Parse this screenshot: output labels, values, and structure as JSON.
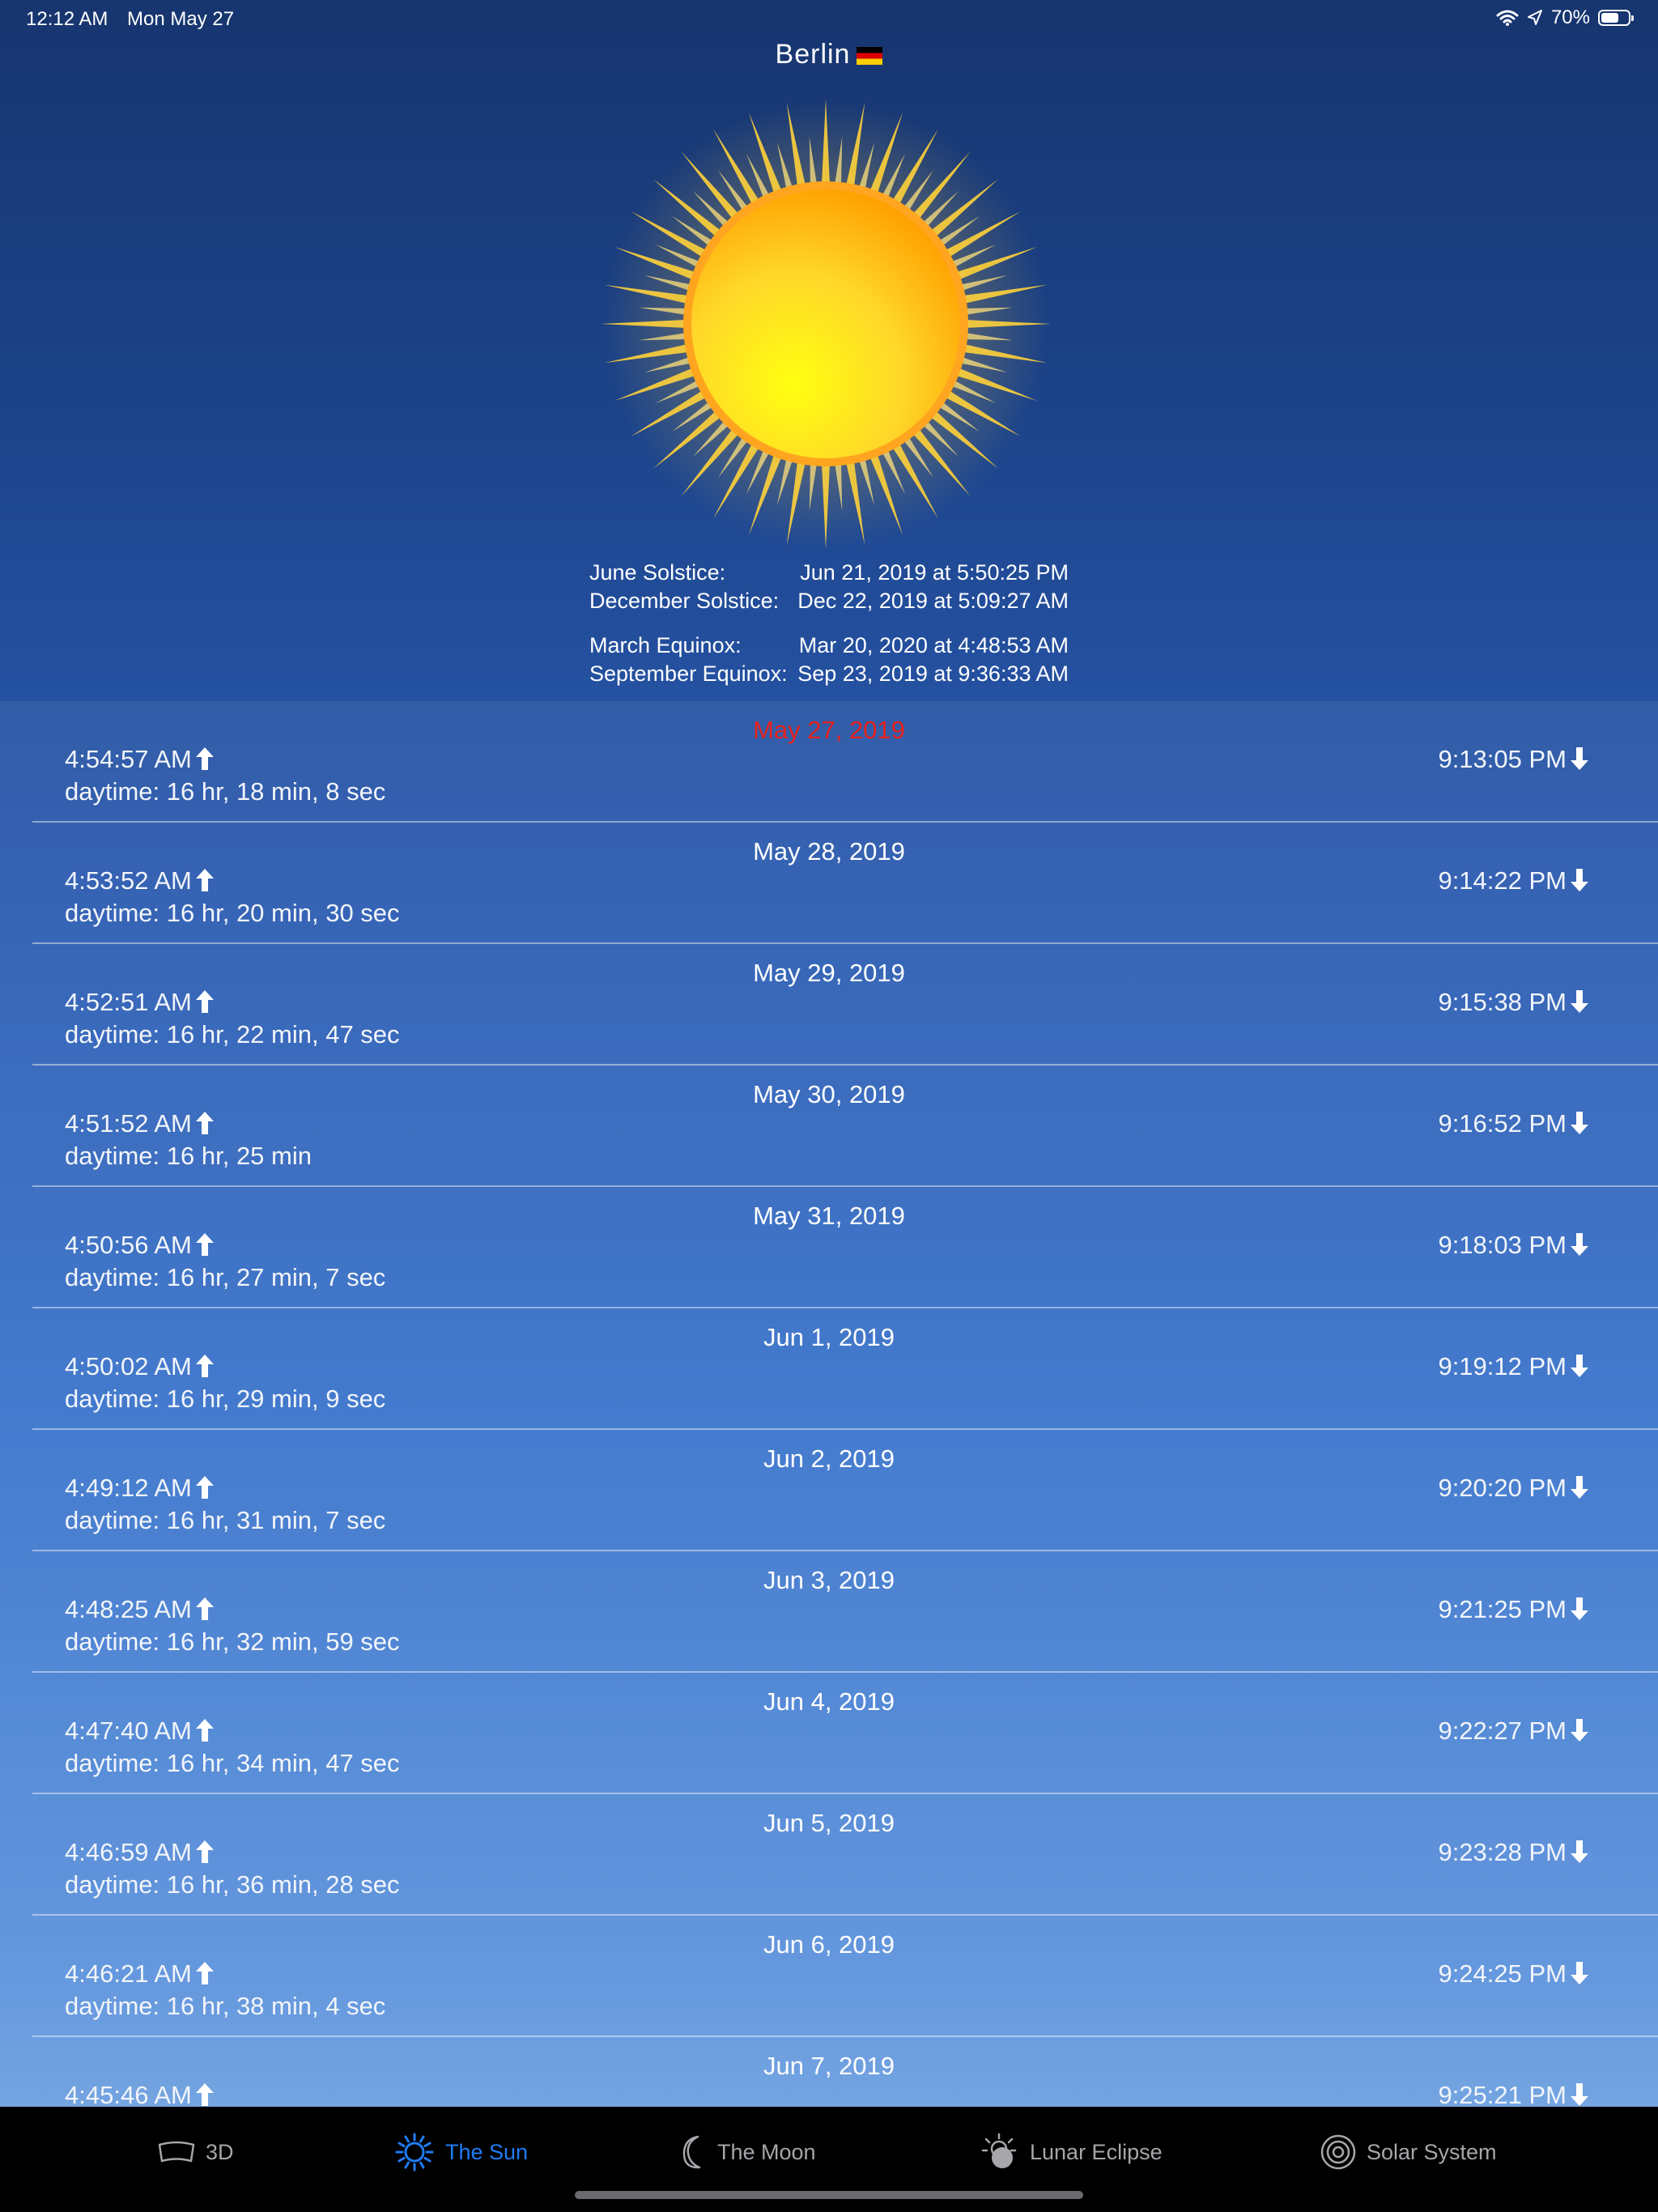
{
  "status": {
    "time": "12:12 AM",
    "date": "Mon May 27",
    "battery": "70%",
    "battery_level": 0.7
  },
  "city": {
    "name": "Berlin"
  },
  "events": [
    {
      "label": "June Solstice:",
      "value": "Jun 21, 2019 at 5:50:25 PM"
    },
    {
      "label": "December Solstice:",
      "value": "Dec 22, 2019 at 5:09:27 AM"
    },
    {
      "label": "March Equinox:",
      "value": "Mar 20, 2020 at 4:48:53 AM"
    },
    {
      "label": "September Equinox:",
      "value": "Sep 23, 2019 at 9:36:33 AM"
    }
  ],
  "days": [
    {
      "date": "May 27, 2019",
      "today": true,
      "rise": "4:54:57 AM",
      "set": "9:13:05 PM",
      "daytime": "daytime: 16 hr, 18 min, 8 sec"
    },
    {
      "date": "May 28, 2019",
      "rise": "4:53:52 AM",
      "set": "9:14:22 PM",
      "daytime": "daytime: 16 hr, 20 min, 30 sec"
    },
    {
      "date": "May 29, 2019",
      "rise": "4:52:51 AM",
      "set": "9:15:38 PM",
      "daytime": "daytime: 16 hr, 22 min, 47 sec"
    },
    {
      "date": "May 30, 2019",
      "rise": "4:51:52 AM",
      "set": "9:16:52 PM",
      "daytime": "daytime: 16 hr, 25 min"
    },
    {
      "date": "May 31, 2019",
      "rise": "4:50:56 AM",
      "set": "9:18:03 PM",
      "daytime": "daytime: 16 hr, 27 min, 7 sec"
    },
    {
      "date": "Jun 1, 2019",
      "rise": "4:50:02 AM",
      "set": "9:19:12 PM",
      "daytime": "daytime: 16 hr, 29 min, 9 sec"
    },
    {
      "date": "Jun 2, 2019",
      "rise": "4:49:12 AM",
      "set": "9:20:20 PM",
      "daytime": "daytime: 16 hr, 31 min, 7 sec"
    },
    {
      "date": "Jun 3, 2019",
      "rise": "4:48:25 AM",
      "set": "9:21:25 PM",
      "daytime": "daytime: 16 hr, 32 min, 59 sec"
    },
    {
      "date": "Jun 4, 2019",
      "rise": "4:47:40 AM",
      "set": "9:22:27 PM",
      "daytime": "daytime: 16 hr, 34 min, 47 sec"
    },
    {
      "date": "Jun 5, 2019",
      "rise": "4:46:59 AM",
      "set": "9:23:28 PM",
      "daytime": "daytime: 16 hr, 36 min, 28 sec"
    },
    {
      "date": "Jun 6, 2019",
      "rise": "4:46:21 AM",
      "set": "9:24:25 PM",
      "daytime": "daytime: 16 hr, 38 min, 4 sec"
    },
    {
      "date": "Jun 7, 2019",
      "rise": "4:45:46 AM",
      "set": "9:25:21 PM",
      "daytime": ""
    }
  ],
  "tabs": [
    {
      "label": "3D",
      "icon": "3d-view-icon"
    },
    {
      "label": "The Sun",
      "icon": "sun-icon",
      "active": true
    },
    {
      "label": "The Moon",
      "icon": "moon-icon"
    },
    {
      "label": "Lunar Eclipse",
      "icon": "lunar-eclipse-icon"
    },
    {
      "label": "Solar System",
      "icon": "solar-system-icon"
    }
  ],
  "colors": {
    "today": "#e8221d",
    "active_tab": "#1f7cf5",
    "inactive_tab": "#a6a6ab"
  }
}
